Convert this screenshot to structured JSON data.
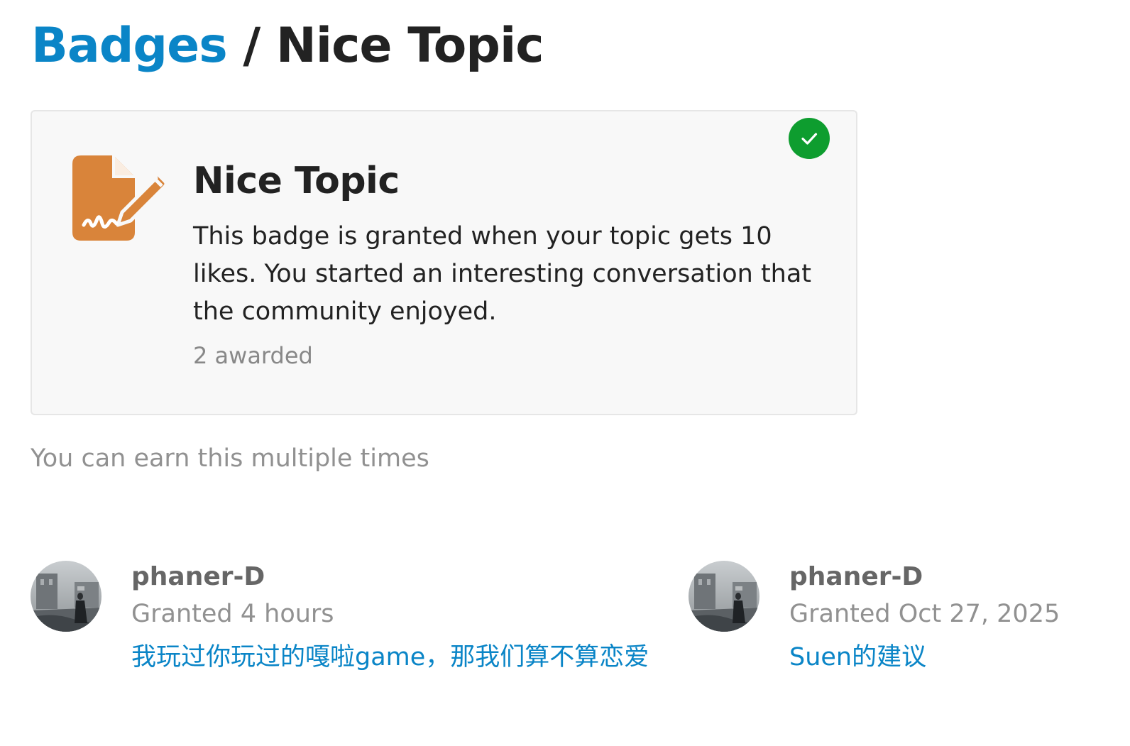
{
  "header": {
    "breadcrumb_link": "Badges",
    "separator": "/",
    "current": "Nice Topic"
  },
  "badge": {
    "name": "Nice Topic",
    "icon": "signed-document-pen-icon",
    "description": "This badge is granted when your topic gets 10 likes. You started an interesting conversation that the community enjoyed.",
    "awarded": "2 awarded",
    "granted_check_icon": "checkmark-icon"
  },
  "multiple_note": "You can earn this multiple times",
  "grants": [
    {
      "username": "phaner-D",
      "granted": "Granted 4 hours",
      "topic": "我玩过你玩过的嘎啦game，那我们算不算恋爱"
    },
    {
      "username": "phaner-D",
      "granted": "Granted Oct 27, 2025",
      "topic": "Suen的建议"
    }
  ],
  "colors": {
    "link": "#0a85c7",
    "badge_icon": "#d9843a",
    "check": "#0e9d2f"
  }
}
